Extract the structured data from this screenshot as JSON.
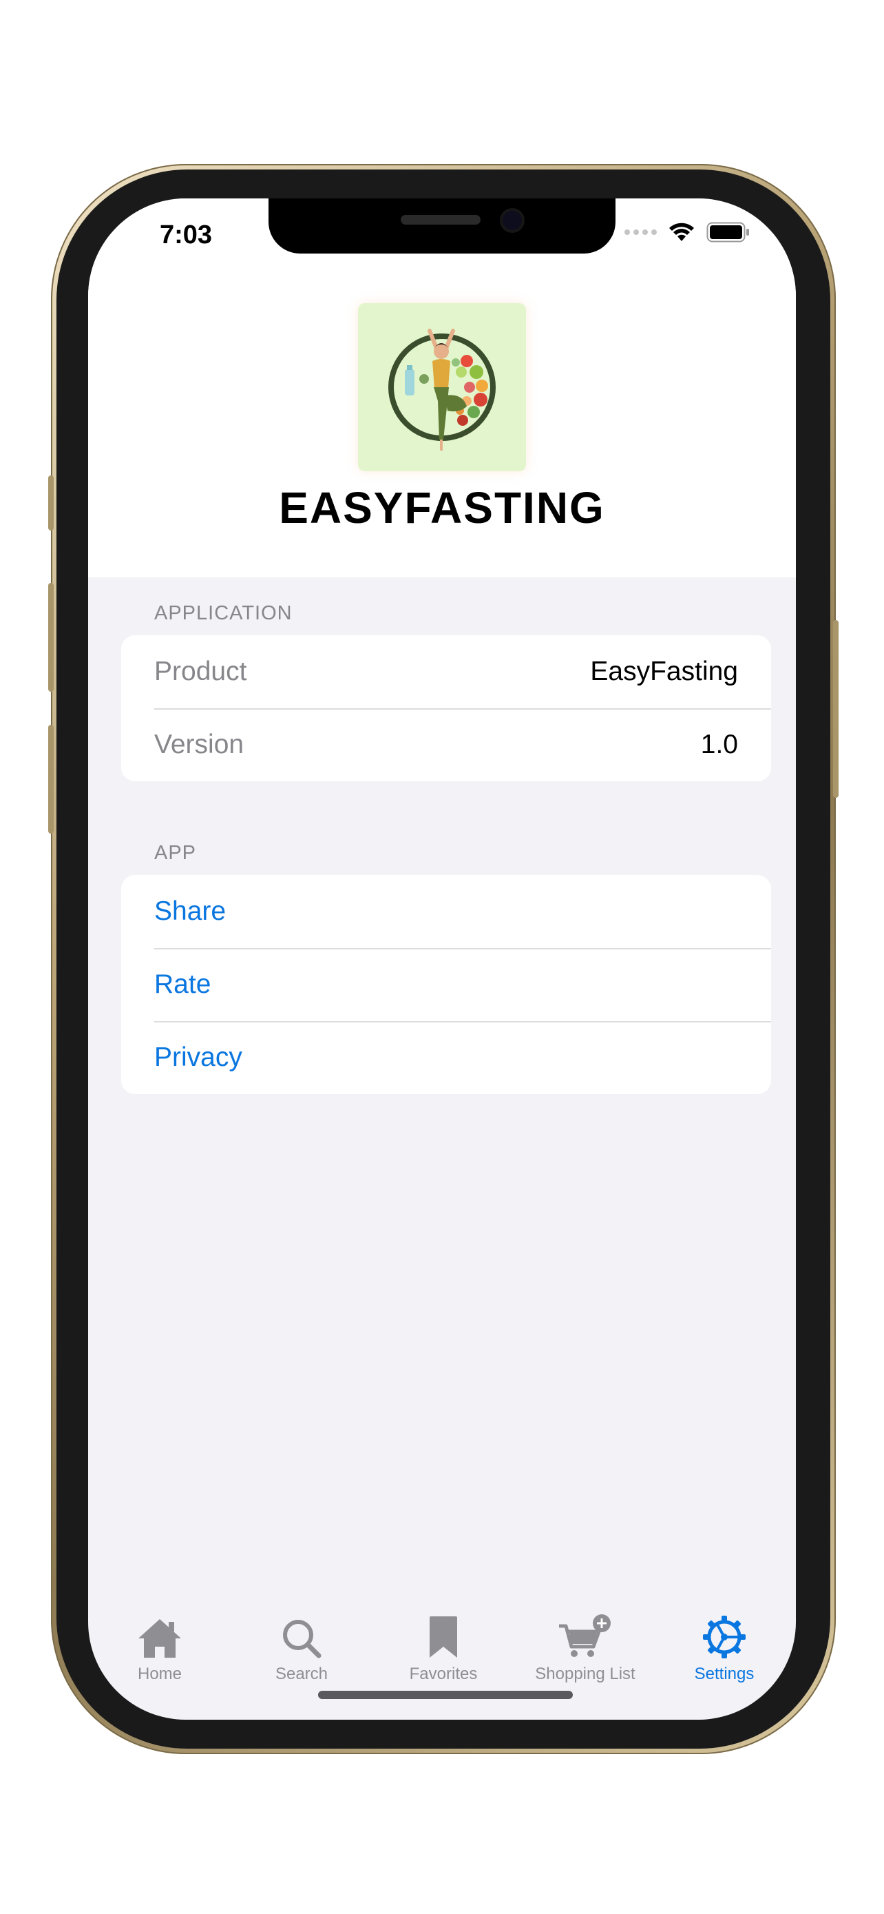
{
  "status_bar": {
    "time": "7:03"
  },
  "header": {
    "app_name": "EASYFASTING",
    "logo": "yoga-woman-food-circle-logo"
  },
  "sections": {
    "application": {
      "title": "APPLICATION",
      "rows": [
        {
          "label": "Product",
          "value": "EasyFasting"
        },
        {
          "label": "Version",
          "value": "1.0"
        }
      ]
    },
    "app": {
      "title": "APP",
      "links": [
        "Share",
        "Rate",
        "Privacy"
      ]
    }
  },
  "tab_bar": {
    "tabs": [
      {
        "label": "Home",
        "icon": "house-icon",
        "active": false
      },
      {
        "label": "Search",
        "icon": "magnifier-icon",
        "active": false
      },
      {
        "label": "Favorites",
        "icon": "bookmark-icon",
        "active": false
      },
      {
        "label": "Shopping List",
        "icon": "cart-plus-icon",
        "active": false
      },
      {
        "label": "Settings",
        "icon": "gear-icon",
        "active": true
      }
    ]
  },
  "colors": {
    "accent": "#0a76e0",
    "inactive": "#8e8e93",
    "grouped_background": "#f2f2f7",
    "logo_background": "#e3f5cc"
  }
}
